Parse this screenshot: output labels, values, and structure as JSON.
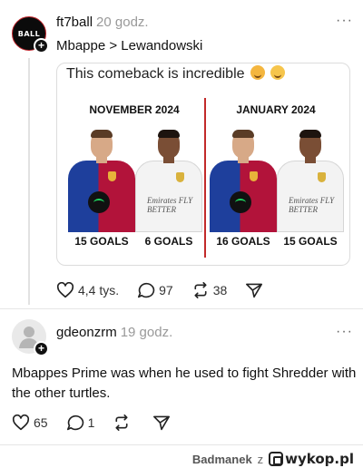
{
  "post1": {
    "avatar_text": "BALL",
    "username": "ft7ball",
    "time": "20 godz.",
    "more_icon": "···",
    "text": "Mbappe > Lewandowski",
    "quote": {
      "text": "This comeback is incredible",
      "emoji_icons": [
        "hot-face-emoji",
        "relieved-face-emoji"
      ],
      "panels": [
        {
          "title": "NOVEMBER 2024",
          "goals_left": "15 GOALS",
          "goals_right": "6 GOALS"
        },
        {
          "title": "JANUARY 2024",
          "goals_left": "16 GOALS",
          "goals_right": "15 GOALS"
        }
      ],
      "sponsor_text": "Emirates FLY BETTER"
    },
    "likes": "4,4 tys.",
    "comments": "97",
    "reposts": "38"
  },
  "post2": {
    "username": "gdeonzrm",
    "time": "19 godz.",
    "more_icon": "···",
    "text_line1": "Mbappes Prime was when he used to fight Shredder with",
    "text_line2": "the other turtles.",
    "likes": "65",
    "comments": "1"
  },
  "footer": {
    "author": "Badmanek",
    "separator": "z",
    "site": "wykop.pl"
  },
  "colors": {
    "divider_red": "#c22a2a",
    "barca_blue": "#1e3f9c",
    "barca_red": "#b2133a"
  }
}
